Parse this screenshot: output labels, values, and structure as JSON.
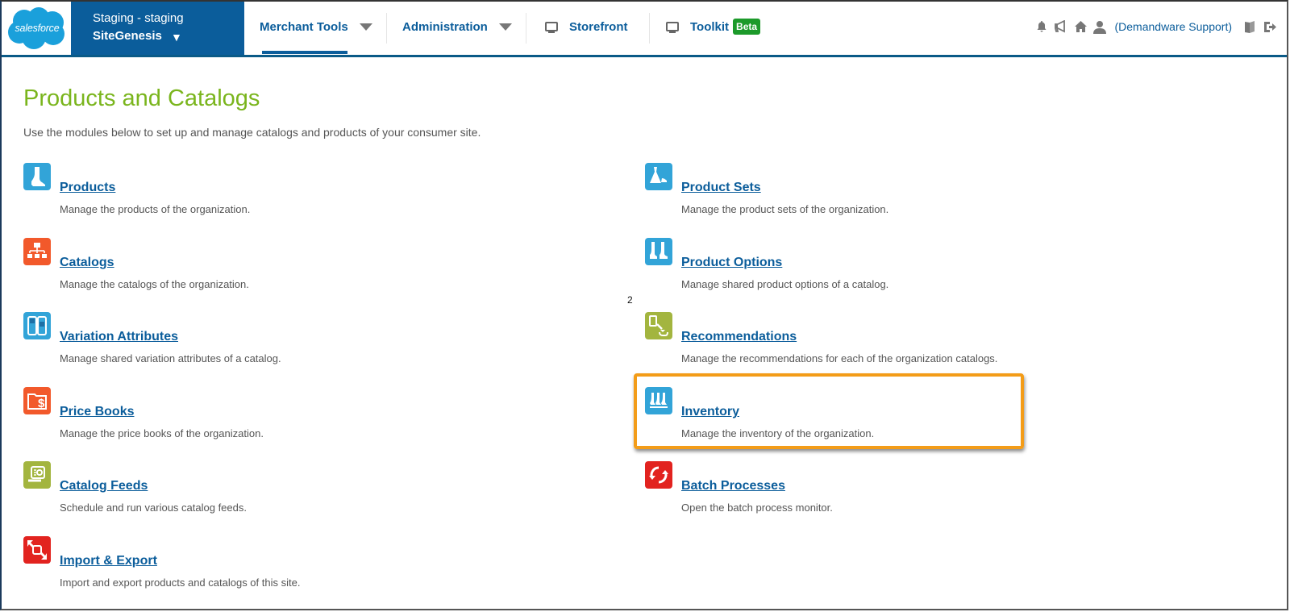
{
  "header": {
    "logo_text": "salesforce",
    "site_selector": {
      "instance": "Staging - staging",
      "site": "SiteGenesis",
      "caret": "▼"
    },
    "nav": [
      {
        "label": "Merchant Tools",
        "has_dropdown": true,
        "active": true
      },
      {
        "label": "Administration",
        "has_dropdown": true,
        "active": false
      },
      {
        "label": "Storefront",
        "icon": "monitor-icon"
      },
      {
        "label": "Toolkit",
        "icon": "monitor-icon",
        "badge": "Beta"
      }
    ],
    "utilities": {
      "icons": [
        "bell-icon",
        "megaphone-icon",
        "home-icon",
        "user-icon"
      ],
      "user_name": "(Demandware Support)",
      "trailing_icons": [
        "book-icon",
        "logout-icon"
      ]
    }
  },
  "page": {
    "title": "Products and Catalogs",
    "description": "Use the modules below to set up and manage catalogs and products of your consumer site.",
    "stray_marker": "2"
  },
  "modules": {
    "left": [
      {
        "title": "Products",
        "description": "Manage the products of the organization.",
        "icon": "boot-icon",
        "color": "#32a4d8"
      },
      {
        "title": "Catalogs",
        "description": "Manage the catalogs of the organization.",
        "icon": "hierarchy-icon",
        "color": "#f2592b"
      },
      {
        "title": "Variation Attributes",
        "description": "Manage shared variation attributes of a catalog.",
        "icon": "variation-icon",
        "color": "#32a4d8"
      },
      {
        "title": "Price Books",
        "description": "Manage the price books of the organization.",
        "icon": "price-book-icon",
        "color": "#f2592b"
      },
      {
        "title": "Catalog Feeds",
        "description": "Schedule and run various catalog feeds.",
        "icon": "feed-icon",
        "color": "#a3b53f"
      },
      {
        "title": "Import & Export",
        "description": "Import and export products and catalogs of this site.",
        "icon": "import-export-icon",
        "color": "#e2231f"
      }
    ],
    "right": [
      {
        "title": "Product Sets",
        "description": "Manage the product sets of the organization.",
        "icon": "dress-icon",
        "color": "#32a4d8"
      },
      {
        "title": "Product Options",
        "description": "Manage shared product options of a catalog.",
        "icon": "boots-icon",
        "color": "#32a4d8"
      },
      {
        "title": "Recommendations",
        "description": "Manage the recommendations for each of the organization catalogs.",
        "icon": "recommendation-icon",
        "color": "#a3b53f"
      },
      {
        "title": "Inventory",
        "description": "Manage the inventory of the organization.",
        "icon": "inventory-icon",
        "color": "#32a4d8",
        "highlighted": true
      },
      {
        "title": "Batch Processes",
        "description": "Open the batch process monitor.",
        "icon": "refresh-icon",
        "color": "#e2231f"
      }
    ]
  },
  "colors": {
    "brand_blue": "#0b5d9b",
    "title_green": "#7ab51d",
    "highlight_orange": "#f39c18",
    "beta_green": "#1c9a2a"
  }
}
